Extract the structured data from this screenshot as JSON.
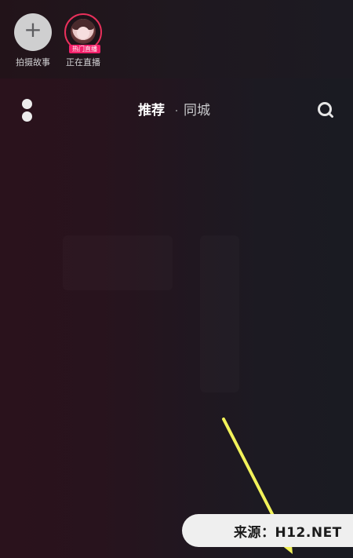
{
  "stories": [
    {
      "label": "拍摄故事",
      "icon": "plus-icon",
      "glyph": "+"
    },
    {
      "label": "正在直播",
      "icon": "avatar",
      "badge": "热门直播"
    }
  ],
  "nav": {
    "menu_icon": "menu-dots-icon",
    "tabs": [
      {
        "label": "推荐",
        "active": true
      },
      {
        "label": "同城",
        "active": false
      }
    ],
    "search_icon": "search-icon"
  },
  "watermark": {
    "text": "来源：H12.NET"
  },
  "colors": {
    "live_accent": "#f2206a",
    "arrow": "#f2f25a",
    "watermark_bg": "#efefef"
  }
}
